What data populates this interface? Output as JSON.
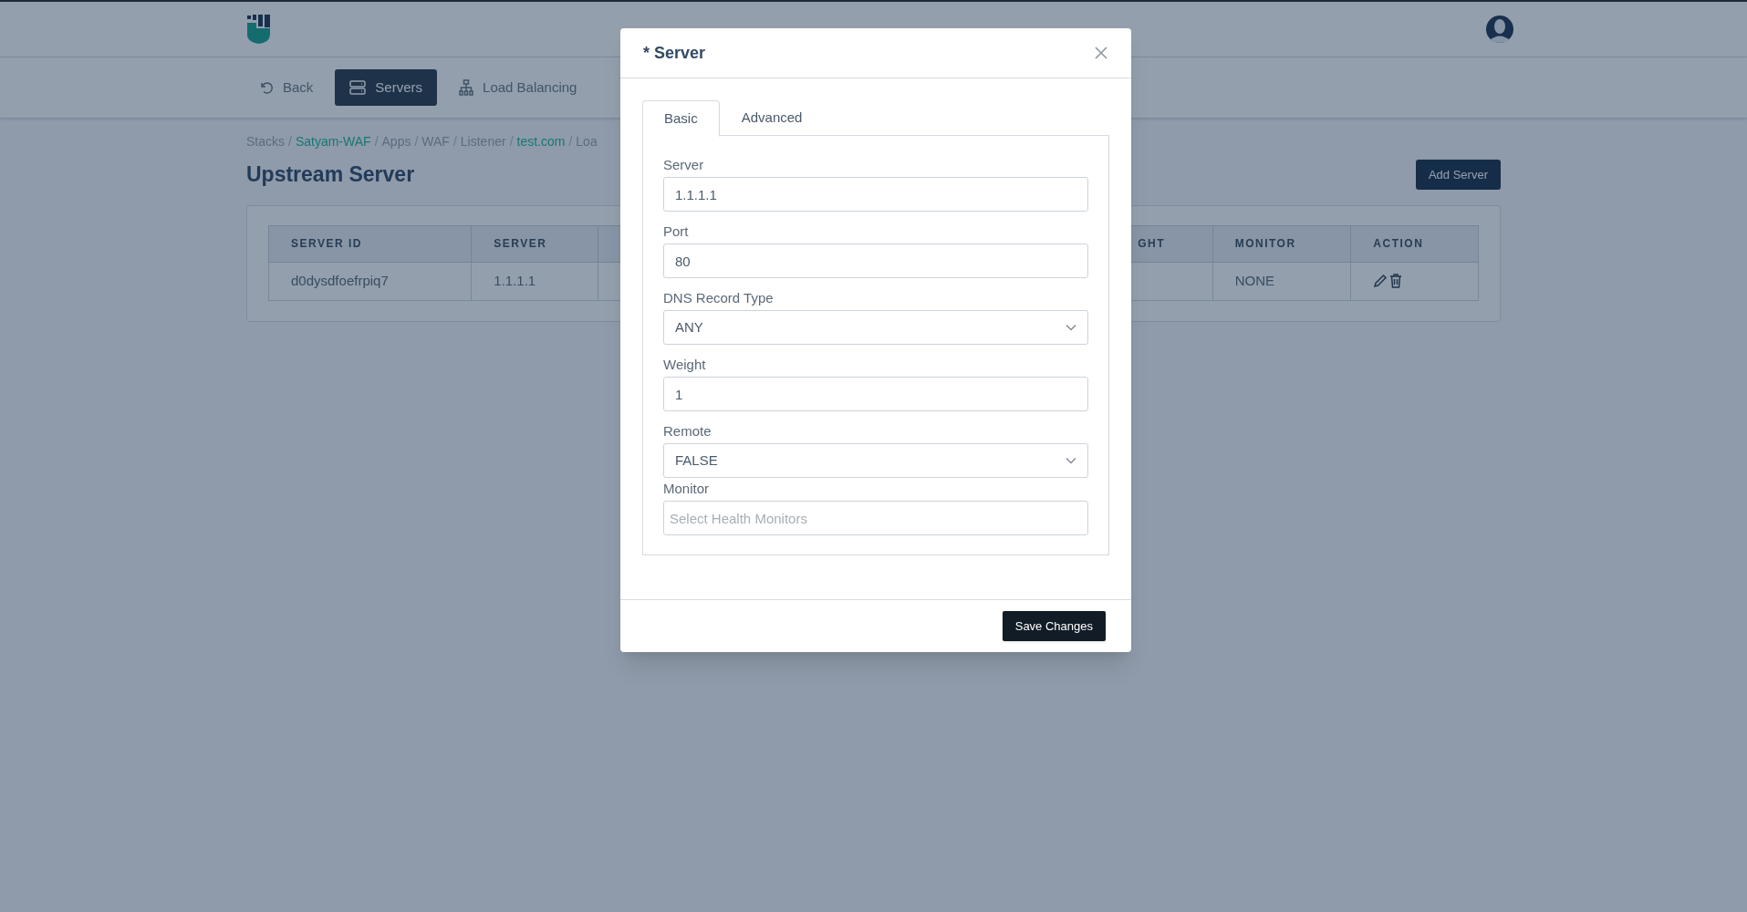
{
  "nav": [
    {
      "kind": "back",
      "label": "Back",
      "selected": false
    },
    {
      "kind": "servers",
      "label": "Servers",
      "selected": true
    },
    {
      "kind": "balancing",
      "label": "Load Balancing",
      "selected": false
    }
  ],
  "breadcrumb": [
    {
      "label": "Stacks",
      "kind": "text"
    },
    {
      "label": "/",
      "kind": "separator"
    },
    {
      "label": "Satyam-WAF",
      "kind": "link"
    },
    {
      "label": "/",
      "kind": "separator"
    },
    {
      "label": "Apps",
      "kind": "text"
    },
    {
      "label": "/",
      "kind": "separator"
    },
    {
      "label": "WAF",
      "kind": "text"
    },
    {
      "label": "/",
      "kind": "separator"
    },
    {
      "label": "Listener",
      "kind": "text"
    },
    {
      "label": "/",
      "kind": "separator"
    },
    {
      "label": "test.com",
      "kind": "link"
    },
    {
      "label": "/",
      "kind": "separator"
    },
    {
      "label": "Loa",
      "kind": "text"
    }
  ],
  "page_title": "Upstream Server",
  "add_button": "Add Server",
  "table": {
    "columns": [
      "SERVER ID",
      "SERVER",
      "GHT",
      "MONITOR",
      "ACTION"
    ],
    "rows": [
      {
        "server_id": "d0dysdfoefrpiq7",
        "server": "1.1.1.1",
        "monitor": "NONE"
      }
    ]
  },
  "modal": {
    "title": "* Server",
    "tabs": [
      {
        "label": "Basic",
        "selected": true
      },
      {
        "label": "Advanced",
        "selected": false
      }
    ],
    "fields": [
      {
        "label": "Server",
        "kind": "text",
        "value": "1.1.1.1"
      },
      {
        "label": "Port",
        "kind": "text",
        "value": "80"
      },
      {
        "label": "DNS Record Type",
        "kind": "select",
        "value": "ANY"
      },
      {
        "label": "Weight",
        "kind": "text",
        "value": "1"
      },
      {
        "label": "Remote",
        "kind": "select",
        "value": "FALSE"
      },
      {
        "label": "Monitor",
        "kind": "text",
        "placeholder": "Select Health Monitors"
      }
    ],
    "save_button": "Save Changes"
  }
}
